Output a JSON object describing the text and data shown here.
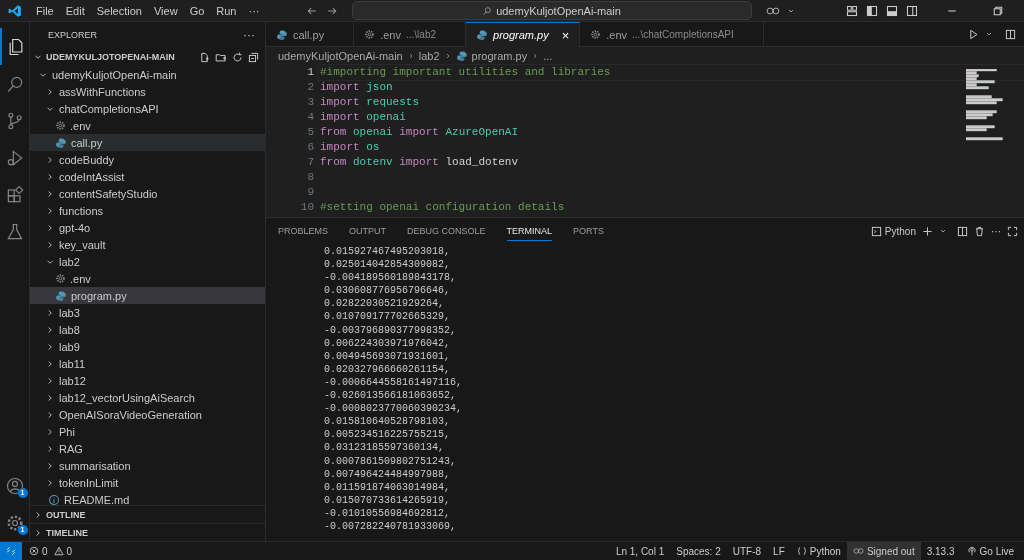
{
  "title_bar": {
    "menu": [
      "File",
      "Edit",
      "Selection",
      "View",
      "Go",
      "Run",
      "···"
    ],
    "search": "udemyKuljotOpenAi-main"
  },
  "activity_bar": {
    "items": [
      {
        "kind": "explorer",
        "selected": true
      },
      {
        "kind": "search",
        "selected": false
      },
      {
        "kind": "source-control",
        "selected": false
      },
      {
        "kind": "run",
        "selected": false
      },
      {
        "kind": "extensions",
        "selected": false
      },
      {
        "kind": "testing",
        "selected": false
      }
    ],
    "account_badge": "1",
    "settings_badge": "1"
  },
  "explorer": {
    "title": "EXPLORER",
    "more": "···",
    "root": "UDEMYKULJOTOPENAI-MAIN",
    "root_expanded": true,
    "tree": [
      {
        "label": "udemyKuljotOpenAi-main",
        "kind": "folder",
        "expanded": true,
        "selected": false,
        "hovered": false,
        "children": [
          {
            "label": "assWithFunctions",
            "kind": "folder",
            "expanded": false,
            "selected": false,
            "hovered": false
          },
          {
            "label": "chatCompletionsAPI",
            "kind": "folder",
            "expanded": true,
            "selected": false,
            "hovered": false,
            "children": [
              {
                "label": ".env",
                "kind": "settings-file",
                "selected": false,
                "hovered": false
              },
              {
                "label": "call.py",
                "kind": "python-file",
                "selected": false,
                "hovered": true
              }
            ]
          },
          {
            "label": "codeBuddy",
            "kind": "folder",
            "expanded": false,
            "selected": false,
            "hovered": false
          },
          {
            "label": "codeIntAssist",
            "kind": "folder",
            "expanded": false,
            "selected": false,
            "hovered": false
          },
          {
            "label": "contentSafetyStudio",
            "kind": "folder",
            "expanded": false,
            "selected": false,
            "hovered": false
          },
          {
            "label": "functions",
            "kind": "folder",
            "expanded": false,
            "selected": false,
            "hovered": false
          },
          {
            "label": "gpt-4o",
            "kind": "folder",
            "expanded": false,
            "selected": false,
            "hovered": false
          },
          {
            "label": "key_vault",
            "kind": "folder",
            "expanded": false,
            "selected": false,
            "hovered": false
          },
          {
            "label": "lab2",
            "kind": "folder",
            "expanded": true,
            "selected": false,
            "hovered": false,
            "children": [
              {
                "label": ".env",
                "kind": "settings-file",
                "selected": false,
                "hovered": false
              },
              {
                "label": "program.py",
                "kind": "python-file",
                "selected": true,
                "hovered": false
              }
            ]
          },
          {
            "label": "lab3",
            "kind": "folder",
            "expanded": false,
            "selected": false,
            "hovered": false
          },
          {
            "label": "lab8",
            "kind": "folder",
            "expanded": false,
            "selected": false,
            "hovered": false
          },
          {
            "label": "lab9",
            "kind": "folder",
            "expanded": false,
            "selected": false,
            "hovered": false
          },
          {
            "label": "lab11",
            "kind": "folder",
            "expanded": false,
            "selected": false,
            "hovered": false
          },
          {
            "label": "lab12",
            "kind": "folder",
            "expanded": false,
            "selected": false,
            "hovered": false
          },
          {
            "label": "lab12_vectorUsingAiSearch",
            "kind": "folder",
            "expanded": false,
            "selected": false,
            "hovered": false
          },
          {
            "label": "OpenAISoraVideoGeneration",
            "kind": "folder",
            "expanded": false,
            "selected": false,
            "hovered": false
          },
          {
            "label": "Phi",
            "kind": "folder",
            "expanded": false,
            "selected": false,
            "hovered": false
          },
          {
            "label": "RAG",
            "kind": "folder",
            "expanded": false,
            "selected": false,
            "hovered": false
          },
          {
            "label": "summarisation",
            "kind": "folder",
            "expanded": false,
            "selected": false,
            "hovered": false
          },
          {
            "label": "tokenInLimit",
            "kind": "folder",
            "expanded": false,
            "selected": false,
            "hovered": false
          },
          {
            "label": "README.md",
            "kind": "info-file",
            "selected": false,
            "hovered": false
          }
        ]
      }
    ],
    "sections": [
      {
        "label": "OUTLINE",
        "expanded": false
      },
      {
        "label": "TIMELINE",
        "expanded": false
      }
    ]
  },
  "editor": {
    "tabs": [
      {
        "label": "call.py",
        "kind": "python-file",
        "selected": false,
        "preview": false
      },
      {
        "label": ".env",
        "description": "...\\lab2",
        "kind": "settings-file",
        "selected": false,
        "preview": false
      },
      {
        "label": "program.py",
        "kind": "python-file",
        "selected": true,
        "preview": true
      },
      {
        "label": ".env",
        "description": "...\\chatCompletionsAPI",
        "kind": "settings-file",
        "selected": false,
        "preview": false
      }
    ],
    "close": "×",
    "breadcrumbs": [
      "udemyKuljotOpenAi-main",
      "lab2",
      "program.py",
      "..."
    ],
    "lines": [
      {
        "number": "1",
        "current": true,
        "tokens": [
          {
            "text": "#importing important utilities and libraries",
            "kind": "comment"
          }
        ]
      },
      {
        "number": "2",
        "current": false,
        "tokens": [
          {
            "text": "import ",
            "kind": "keyword"
          },
          {
            "text": "json",
            "kind": "module"
          }
        ]
      },
      {
        "number": "3",
        "current": false,
        "tokens": [
          {
            "text": "import ",
            "kind": "keyword"
          },
          {
            "text": "requests",
            "kind": "module"
          }
        ]
      },
      {
        "number": "4",
        "current": false,
        "tokens": [
          {
            "text": "import ",
            "kind": "keyword"
          },
          {
            "text": "openai",
            "kind": "module"
          }
        ]
      },
      {
        "number": "5",
        "current": false,
        "tokens": [
          {
            "text": "from ",
            "kind": "keyword"
          },
          {
            "text": "openai ",
            "kind": "module"
          },
          {
            "text": "import ",
            "kind": "keyword"
          },
          {
            "text": "AzureOpenAI",
            "kind": "module"
          }
        ]
      },
      {
        "number": "6",
        "current": false,
        "tokens": [
          {
            "text": "import ",
            "kind": "keyword"
          },
          {
            "text": "os",
            "kind": "module"
          }
        ]
      },
      {
        "number": "7",
        "current": false,
        "tokens": [
          {
            "text": "from ",
            "kind": "keyword"
          },
          {
            "text": "dotenv ",
            "kind": "module"
          },
          {
            "text": "import ",
            "kind": "keyword"
          },
          {
            "text": "load_dotenv",
            "kind": "plain"
          }
        ]
      },
      {
        "number": "8",
        "current": false
      },
      {
        "number": "9",
        "current": false
      },
      {
        "number": "10",
        "current": false,
        "tokens": [
          {
            "text": "#setting openai configuration details",
            "kind": "comment"
          }
        ]
      }
    ]
  },
  "panel": {
    "tabs": [
      {
        "label": "PROBLEMS",
        "selected": false
      },
      {
        "label": "OUTPUT",
        "selected": false
      },
      {
        "label": "DEBUG CONSOLE",
        "selected": false
      },
      {
        "label": "TERMINAL",
        "selected": true
      },
      {
        "label": "PORTS",
        "selected": false
      }
    ],
    "terminal_profile": "Python",
    "more": "···",
    "terminal_lines": [
      "0.015927467495203018,",
      "0.025014042854309082,",
      "-0.004189560189843178,",
      "0.030608776956796646,",
      "0.02822030521929264,",
      "0.010709177702665329,",
      "-0.003796890377998352,",
      "0.006224303971976042,",
      "0.004945693071931601,",
      "0.020327966660261154,",
      "-0.0006644558161497116,",
      "-0.026013566181063652,",
      "-0.0008023770060390234,",
      "0.015810640528798103,",
      "0.005234516225755215,",
      "0.03123185597360134,",
      "0.0007861509802751243,",
      "0.007496424484997988,",
      "0.011591874063014984,",
      "0.015070733614265919,",
      "-0.01010556984692812,",
      "-0.007282240781933069,"
    ]
  },
  "status_bar": {
    "errors": "0",
    "warnings": "0",
    "items": [
      {
        "label": "Ln 1, Col 1",
        "kind": "text",
        "highlighted": false
      },
      {
        "label": "Spaces: 2",
        "kind": "text",
        "highlighted": false
      },
      {
        "label": "UTF-8",
        "kind": "text",
        "highlighted": false
      },
      {
        "label": "LF",
        "kind": "text",
        "highlighted": false
      },
      {
        "label": "Python",
        "kind": "language",
        "highlighted": false
      },
      {
        "label": "Signed out",
        "kind": "account",
        "highlighted": true
      },
      {
        "label": "3.13.3",
        "kind": "text",
        "highlighted": false
      },
      {
        "label": "Go Live",
        "kind": "live",
        "highlighted": false
      }
    ]
  }
}
